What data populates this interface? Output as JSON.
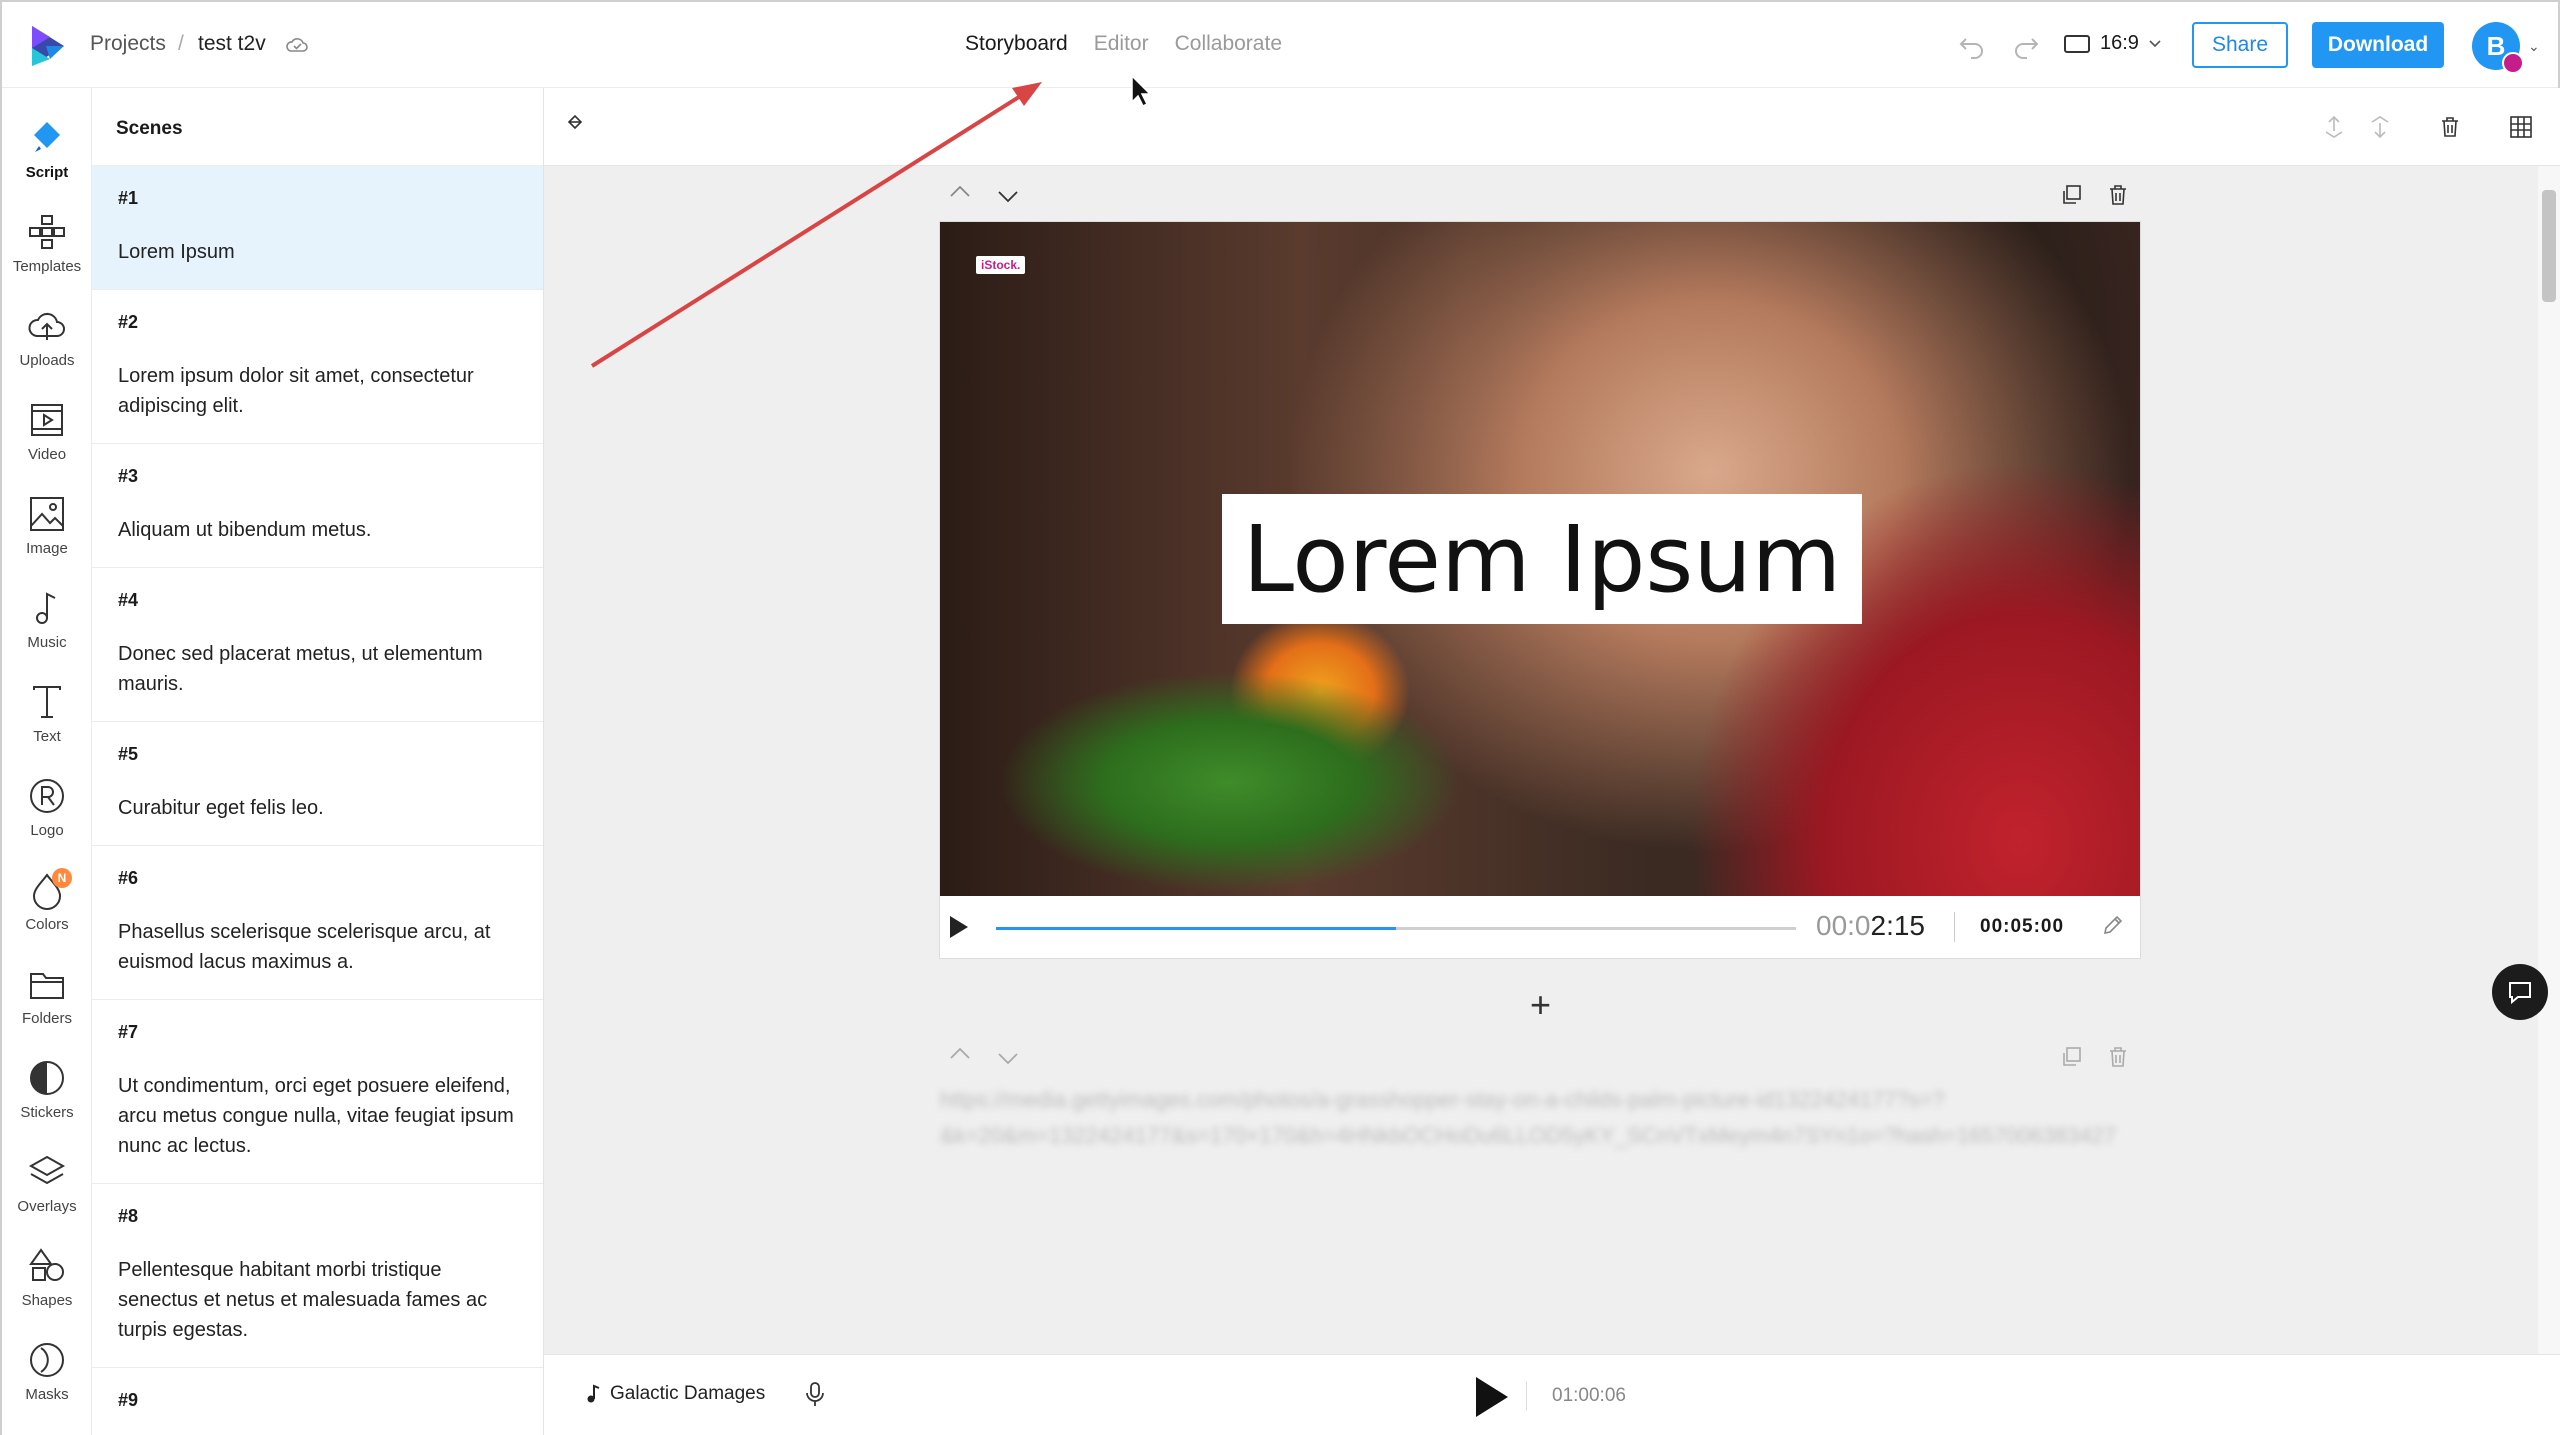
{
  "header": {
    "breadcrumb_projects": "Projects",
    "breadcrumb_sep": "/",
    "project_name": "test t2v",
    "tabs": [
      {
        "label": "Storyboard",
        "active": true
      },
      {
        "label": "Editor",
        "active": false
      },
      {
        "label": "Collaborate",
        "active": false
      }
    ],
    "aspect_ratio": "16:9",
    "share_label": "Share",
    "download_label": "Download",
    "avatar_initial": "B"
  },
  "sidebar": {
    "items": [
      {
        "label": "Script",
        "icon": "script-icon",
        "active": true
      },
      {
        "label": "Templates",
        "icon": "templates-icon"
      },
      {
        "label": "Uploads",
        "icon": "upload-cloud-icon"
      },
      {
        "label": "Video",
        "icon": "video-icon"
      },
      {
        "label": "Image",
        "icon": "image-icon"
      },
      {
        "label": "Music",
        "icon": "music-note-icon"
      },
      {
        "label": "Text",
        "icon": "text-icon"
      },
      {
        "label": "Logo",
        "icon": "logo-r-icon"
      },
      {
        "label": "Colors",
        "icon": "colors-drop-icon",
        "badge": "N"
      },
      {
        "label": "Folders",
        "icon": "folder-icon"
      },
      {
        "label": "Stickers",
        "icon": "sticker-icon"
      },
      {
        "label": "Overlays",
        "icon": "layers-icon"
      },
      {
        "label": "Shapes",
        "icon": "shapes-icon"
      },
      {
        "label": "Masks",
        "icon": "mask-icon"
      }
    ]
  },
  "scenes": {
    "title": "Scenes",
    "items": [
      {
        "num": "#1",
        "text": "Lorem Ipsum"
      },
      {
        "num": "#2",
        "text": "Lorem ipsum dolor sit amet, consectetur adipiscing elit."
      },
      {
        "num": "#3",
        "text": "Aliquam ut bibendum metus."
      },
      {
        "num": "#4",
        "text": "Donec sed placerat metus, ut elementum mauris."
      },
      {
        "num": "#5",
        "text": "Curabitur eget felis leo."
      },
      {
        "num": "#6",
        "text": "Phasellus scelerisque scelerisque arcu, at euismod lacus maximus a."
      },
      {
        "num": "#7",
        "text": "Ut condimentum, orci eget posuere eleifend, arcu metus congue nulla, vitae feugiat ipsum nunc ac lectus."
      },
      {
        "num": "#8",
        "text": "Pellentesque habitant morbi tristique senectus et netus et malesuada fames ac turpis egestas."
      },
      {
        "num": "#9",
        "text": ""
      }
    ]
  },
  "scene_card": {
    "watermark": "iStock.",
    "overlay_text": "Lorem Ipsum",
    "time_current_dim": "00:0",
    "time_current": "2:15",
    "time_total": "00:05:00",
    "progress": 0.5
  },
  "next_scene_broken_image_text": "https://media.gettyimages.com/photos/a-grasshopper-stay-on-a-childs-palm-picture-id1322424177?s=?&k=20&m=1322424177&s=170×170&h=4HNkbOCHoDu6LLOD5yKY_SCnVTxMeym4n7SYn1o=?hash=1657006383427",
  "bottom": {
    "music_title": "Galactic Damages",
    "total_time": "01:00:06"
  },
  "colors": {
    "accent": "#2196f3",
    "active_scene_bg": "#e6f3fd",
    "annotation_arrow": "#d94444"
  }
}
